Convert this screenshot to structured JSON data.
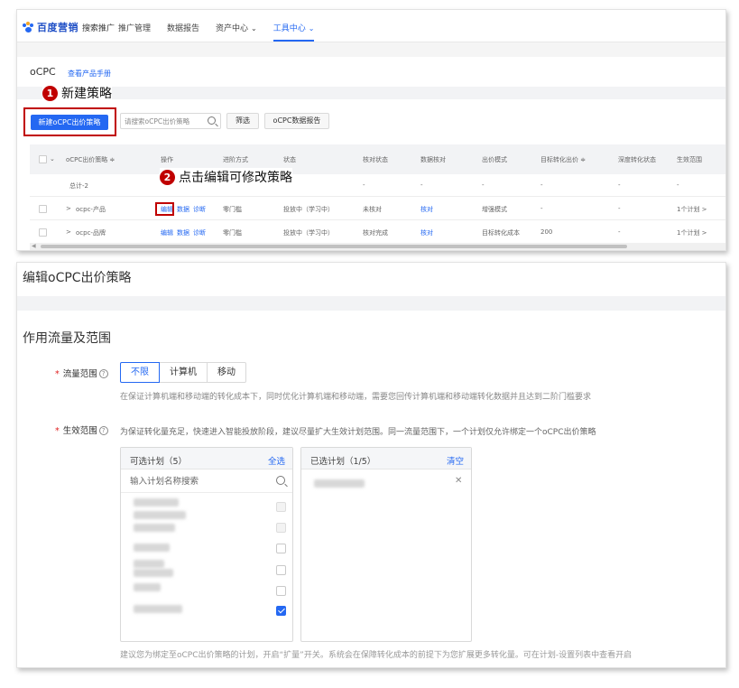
{
  "nav": {
    "brand": "百度营销",
    "sub": "搜索推广",
    "items": [
      {
        "label": "推广管理"
      },
      {
        "label": "数据报告"
      },
      {
        "label": "资产中心"
      },
      {
        "label": "工具中心"
      }
    ]
  },
  "ocpc_list": {
    "title": "oCPC",
    "manual_link": "查看产品手册",
    "new_button": "新建oCPC出价策略",
    "search_placeholder": "请搜索oCPC出价策略",
    "filter_button": "筛选",
    "report_button": "oCPC数据报告",
    "columns": [
      "oCPC出价策略 ≑",
      "操作",
      "进阶方式",
      "状态",
      "核对状态",
      "数据核对",
      "出价模式",
      "目标转化出价 ≑",
      "深度转化状态",
      "生效范围"
    ],
    "total_row": {
      "name": "总计-2",
      "c1": "-",
      "c2": "-",
      "c3": "-",
      "c4": "-",
      "c5": "-",
      "c6": "-"
    },
    "rows": [
      {
        "name": "ocpc-产品",
        "op_edit": "编辑",
        "op_data": "数据",
        "op_diag": "诊断",
        "mode": "零门槛",
        "status": "投放中（学习中）",
        "check_status": "未核对",
        "data_check": "核对",
        "bid_mode": "增强模式",
        "target_bid": "-",
        "deep_status": "-",
        "scope": "1个计划 >"
      },
      {
        "name": "ocpc-品牌",
        "op_edit": "编辑",
        "op_data": "数据",
        "op_diag": "诊断",
        "mode": "零门槛",
        "status": "投放中（学习中）",
        "check_status": "核对完成",
        "data_check": "核对",
        "bid_mode": "目标转化成本",
        "target_bid": "200",
        "deep_status": "-",
        "scope": "1个计划 >"
      }
    ]
  },
  "callouts": {
    "step1": {
      "num": "1",
      "text": "新建策略"
    },
    "step2": {
      "num": "2",
      "text": "点击编辑可修改策略"
    }
  },
  "edit_form": {
    "title": "编辑oCPC出价策略",
    "section": "作用流量及范围",
    "traffic_label": "流量范围",
    "traffic_options": [
      "不限",
      "计算机",
      "移动"
    ],
    "traffic_selected": "不限",
    "traffic_hint": "在保证计算机端和移动端的转化成本下，同时优化计算机端和移动端，需要您回传计算机端和移动端转化数据并且达到二阶门槛要求",
    "scope_label": "生效范围",
    "scope_hint": "为保证转化量充足，快速进入智能投放阶段，建议尽量扩大生效计划范围。同一流量范围下，一个计划仅允许绑定一个oCPC出价策略",
    "available": {
      "title": "可选计划（5）",
      "action": "全选",
      "search_placeholder": "输入计划名称搜索"
    },
    "selected": {
      "title": "已选计划（1/5）",
      "action": "清空"
    },
    "footer_hint": "建议您为绑定至oCPC出价策略的计划，开启“扩量”开关。系统会在保障转化成本的前提下为您扩展更多转化量。可在计划-设置列表中查看开启"
  },
  "colors": {
    "accent": "#2468f2",
    "highlight": "#c00000"
  }
}
